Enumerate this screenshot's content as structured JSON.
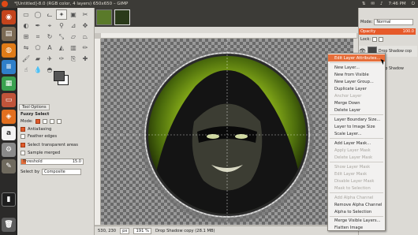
{
  "window": {
    "title": "*[Untitled]-8.0 (RGB color, 4 layers) 650x650 – GIMP",
    "tray_time": "7:46 PM"
  },
  "tool_options": {
    "tab_label": "Tool Options",
    "title": "Fuzzy Select",
    "mode_label": "Mode:",
    "antialiasing": "Antialiasing",
    "feather_edges": "Feather edges",
    "select_transparent": "Select transparent areas",
    "sample_merged": "Sample merged",
    "threshold_label": "Threshold",
    "threshold_value": "15.0",
    "select_by_label": "Select by",
    "select_by_value": "Composite"
  },
  "status": {
    "coords": "530, 230",
    "unit": "px",
    "zoom": "191 %",
    "layer_info": "Drop Shadow copy (28.1 MB)"
  },
  "layers_dock": {
    "mode_label": "Mode:",
    "mode_value": "Normal",
    "opacity_label": "Opacity",
    "opacity_value": "100.0",
    "lock_label": "Lock:",
    "layers": [
      {
        "name": "Drop Shadow cop"
      },
      {
        "name": "Drop Shadow"
      },
      {
        "name": "Sh"
      },
      {
        "name": "Bac"
      }
    ]
  },
  "context_menu": {
    "items": [
      {
        "label": "Edit Layer Attributes...",
        "state": "highlight"
      },
      {
        "label": "New Layer...",
        "state": "normal"
      },
      {
        "label": "New from Visible",
        "state": "normal"
      },
      {
        "label": "New Layer Group...",
        "state": "normal"
      },
      {
        "label": "Duplicate Layer",
        "state": "normal"
      },
      {
        "label": "Anchor Layer",
        "state": "disabled"
      },
      {
        "label": "Merge Down",
        "state": "normal"
      },
      {
        "label": "Delete Layer",
        "state": "normal"
      },
      {
        "label": "Layer Boundary Size...",
        "state": "normal"
      },
      {
        "label": "Layer to Image Size",
        "state": "normal"
      },
      {
        "label": "Scale Layer...",
        "state": "normal"
      },
      {
        "label": "Add Layer Mask...",
        "state": "normal"
      },
      {
        "label": "Apply Layer Mask",
        "state": "disabled"
      },
      {
        "label": "Delete Layer Mask",
        "state": "disabled"
      },
      {
        "label": "Show Layer Mask",
        "state": "disabled"
      },
      {
        "label": "Edit Layer Mask",
        "state": "disabled"
      },
      {
        "label": "Disable Layer Mask",
        "state": "disabled"
      },
      {
        "label": "Mask to Selection",
        "state": "disabled"
      },
      {
        "label": "Add Alpha Channel",
        "state": "disabled"
      },
      {
        "label": "Remove Alpha Channel",
        "state": "normal"
      },
      {
        "label": "Alpha to Selection",
        "state": "normal"
      },
      {
        "label": "Merge Visible Layers...",
        "state": "normal"
      },
      {
        "label": "Flatten Image",
        "state": "normal"
      }
    ]
  },
  "colors": {
    "accent": "#e66e3a",
    "panel_bg": "#dcdad5",
    "dark_bg": "#3c3b37"
  }
}
